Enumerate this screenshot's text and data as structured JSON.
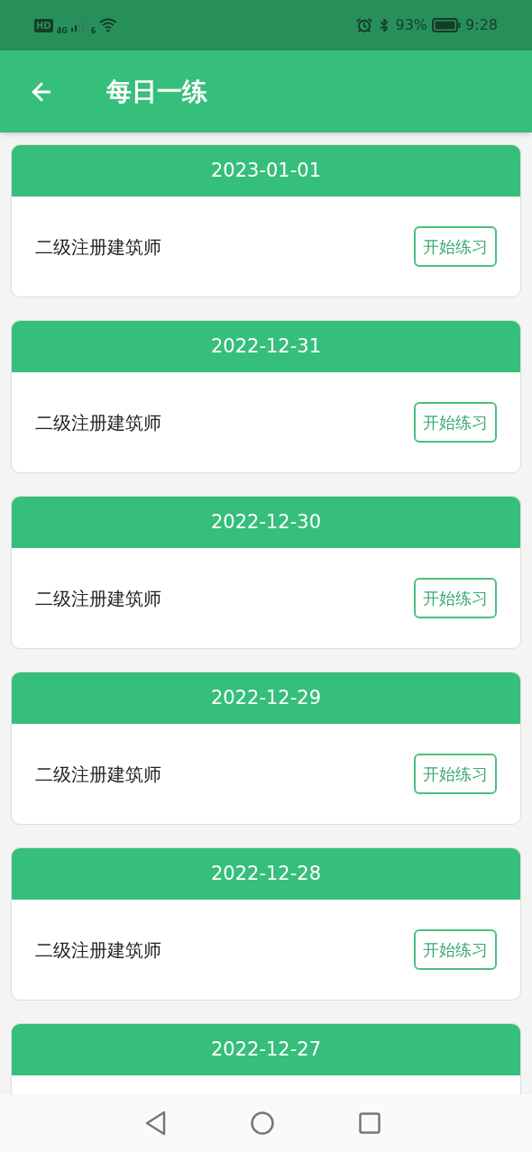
{
  "status_bar": {
    "hd": "HD",
    "network": "4G",
    "wifi_badge": "6",
    "battery": "93%",
    "time": "9:28"
  },
  "header": {
    "title": "每日一练"
  },
  "cards": [
    {
      "date": "2023-01-01",
      "subject": "二级注册建筑师",
      "button": "开始练习"
    },
    {
      "date": "2022-12-31",
      "subject": "二级注册建筑师",
      "button": "开始练习"
    },
    {
      "date": "2022-12-30",
      "subject": "二级注册建筑师",
      "button": "开始练习"
    },
    {
      "date": "2022-12-29",
      "subject": "二级注册建筑师",
      "button": "开始练习"
    },
    {
      "date": "2022-12-28",
      "subject": "二级注册建筑师",
      "button": "开始练习"
    },
    {
      "date": "2022-12-27"
    }
  ]
}
